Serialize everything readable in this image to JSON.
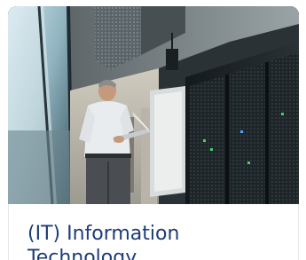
{
  "card": {
    "title": "(IT) Information Technology",
    "image_subject": "man with laptop in server room",
    "colors": {
      "title": "#1d3c78",
      "background": "#ffffff"
    }
  }
}
